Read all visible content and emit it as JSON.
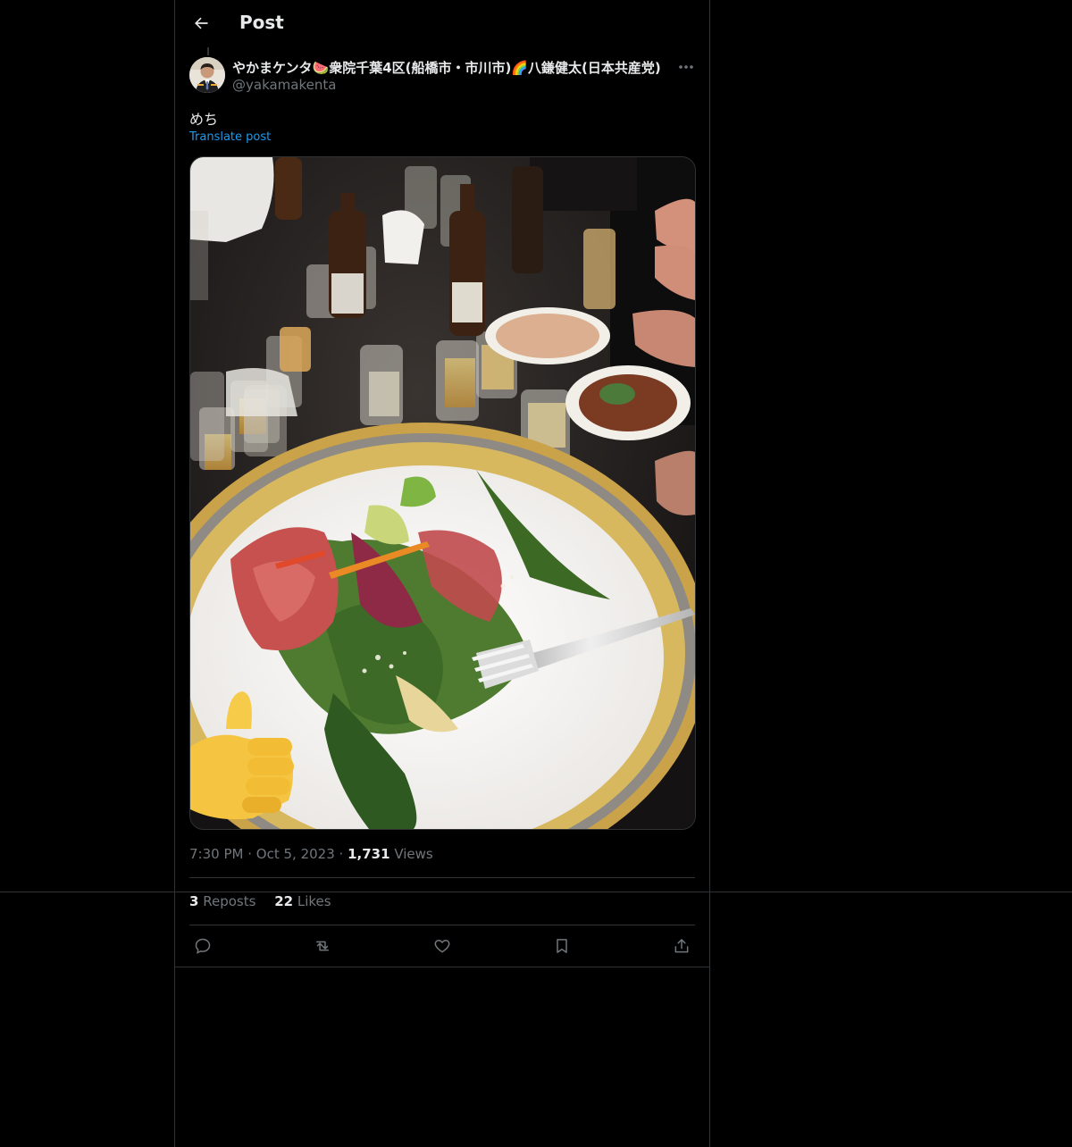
{
  "header": {
    "title": "Post",
    "back_icon": "arrow-left-icon"
  },
  "post": {
    "author": {
      "display_name": "やかまケンタ🍉衆院千葉4区(船橋市・市川市)🌈八鎌健太(日本共産党)",
      "handle": "@yakamakenta"
    },
    "text": "めち",
    "translate_label": "Translate post",
    "image_alt": "Salad with prosciutto and greens on a gold-rimmed plate with a fork, drinks on table, thumbs-up emoji",
    "time": "7:30 PM",
    "date": "Oct 5, 2023",
    "views_count": "1,731",
    "views_label": "Views",
    "reposts_count": "3",
    "reposts_label": "Reposts",
    "likes_count": "22",
    "likes_label": "Likes"
  },
  "actions": [
    {
      "name": "reply",
      "icon": "reply-icon"
    },
    {
      "name": "repost",
      "icon": "repost-icon"
    },
    {
      "name": "like",
      "icon": "heart-icon"
    },
    {
      "name": "bookmark",
      "icon": "bookmark-icon"
    },
    {
      "name": "share",
      "icon": "share-icon"
    }
  ],
  "colors": {
    "background": "#000000",
    "text_primary": "#e7e9ea",
    "text_secondary": "#71767b",
    "link": "#1d9bf0",
    "border": "#2f3336"
  }
}
